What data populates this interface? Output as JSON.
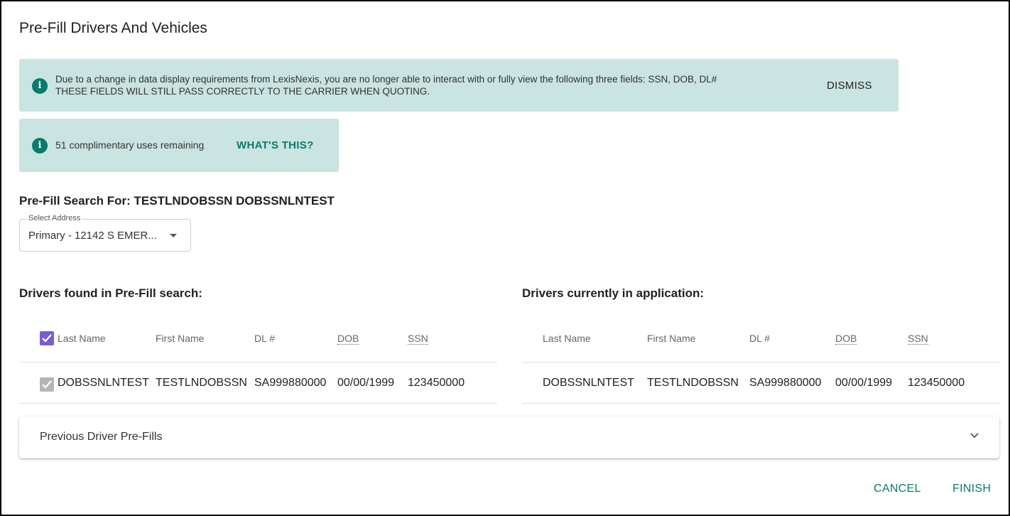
{
  "dialog": {
    "title": "Pre-Fill Drivers And Vehicles"
  },
  "notice": {
    "line1": "Due to a change in data display requirements from LexisNexis, you are no longer able to interact with or fully view the following three fields: SSN, DOB, DL#",
    "line2": "THESE FIELDS WILL STILL PASS CORRECTLY TO THE CARRIER WHEN QUOTING.",
    "dismiss_label": "DISMISS",
    "icon": "info-icon"
  },
  "usage": {
    "message": "51 complimentary uses remaining",
    "link_label": "WHAT'S THIS?",
    "icon": "info-icon"
  },
  "search": {
    "heading": "Pre-Fill Search For: TESTLNDOBSSN DOBSSNLNTEST",
    "address_label": "Select Address",
    "address_value": "Primary - 12142 S EMER..."
  },
  "found": {
    "heading": "Drivers found in Pre-Fill search:",
    "columns": [
      "Last Name",
      "First Name",
      "DL #",
      "DOB",
      "SSN"
    ],
    "header_checked": true,
    "rows": [
      {
        "checked": true,
        "cells": [
          "DOBSSNLNTEST",
          "TESTLNDOBSSN",
          "SA999880000",
          "00/00/1999",
          "123450000"
        ]
      }
    ]
  },
  "current": {
    "heading": "Drivers currently in application:",
    "columns": [
      "Last Name",
      "First Name",
      "DL #",
      "DOB",
      "SSN"
    ],
    "rows": [
      {
        "cells": [
          "DOBSSNLNTEST",
          "TESTLNDOBSSN",
          "SA999880000",
          "00/00/1999",
          "123450000"
        ]
      }
    ]
  },
  "previous": {
    "label": "Previous Driver Pre-Fills"
  },
  "actions": {
    "cancel_label": "CANCEL",
    "finish_label": "FINISH"
  },
  "colors": {
    "accent": "#0b7a6b",
    "alert_bg": "#c9e4e1",
    "checkbox": "#7b5ccf"
  }
}
